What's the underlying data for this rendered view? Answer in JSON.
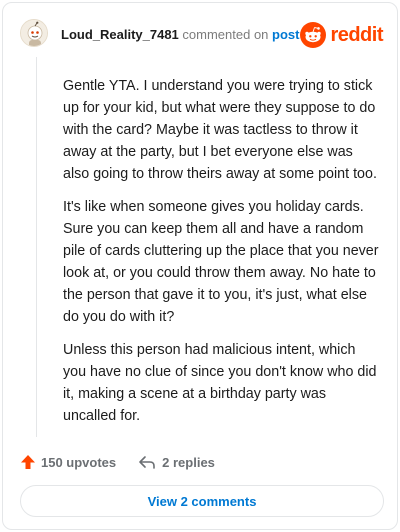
{
  "header": {
    "username": "Loud_Reality_7481",
    "action_text": "commented on",
    "post_link": "post",
    "logo_text": "reddit"
  },
  "comment": {
    "paragraphs": [
      "Gentle YTA. I understand you were trying to stick up for your kid, but what were they suppose to do with the card? Maybe it was tactless to throw it away at the party, but I bet everyone else was also going to throw theirs away at some point too.",
      "It's like when someone gives you holiday cards. Sure you can keep them all and have a random pile of cards cluttering up the place that you never look at, or you could throw them away. No hate to the person that gave it to you, it's just, what else do you do with it?",
      "Unless this person had malicious intent, which you have no clue of since you don't know who did it, making a scene at a birthday party was uncalled for."
    ]
  },
  "footer": {
    "upvotes": "150 upvotes",
    "replies": "2 replies",
    "view_button": "View 2 comments"
  },
  "colors": {
    "brand": "#ff4500",
    "link": "#0079d3",
    "muted": "#7c7c7c"
  },
  "icons": {
    "avatar": "snoo-avatar",
    "logo": "reddit-snoo-icon",
    "upvote": "upvote-arrow-icon",
    "reply": "reply-arrow-icon"
  }
}
